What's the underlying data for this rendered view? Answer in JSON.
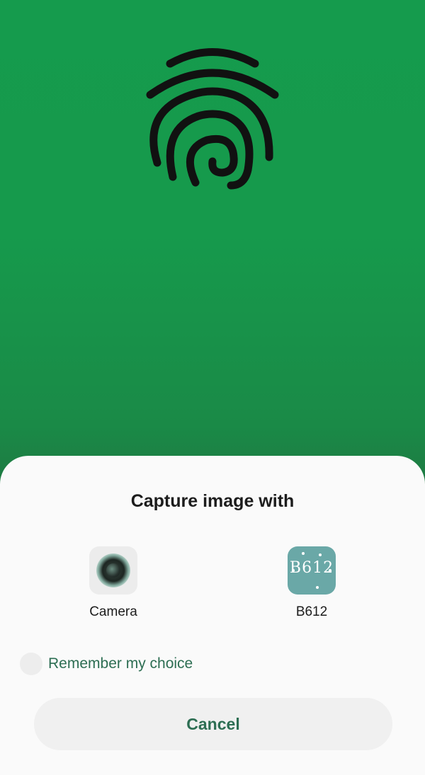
{
  "background": {
    "colors": [
      "#159b4d",
      "#22633b"
    ],
    "icon": "fingerprint-icon"
  },
  "chooser": {
    "title": "Capture image with",
    "apps": [
      {
        "label": "Camera",
        "icon": "camera-app-icon"
      },
      {
        "label": "B612",
        "icon": "b612-app-icon",
        "icon_text": "B612"
      }
    ],
    "remember_label": "Remember my choice",
    "remember_checked": false,
    "cancel_label": "Cancel",
    "accent": "#2d6e53"
  }
}
